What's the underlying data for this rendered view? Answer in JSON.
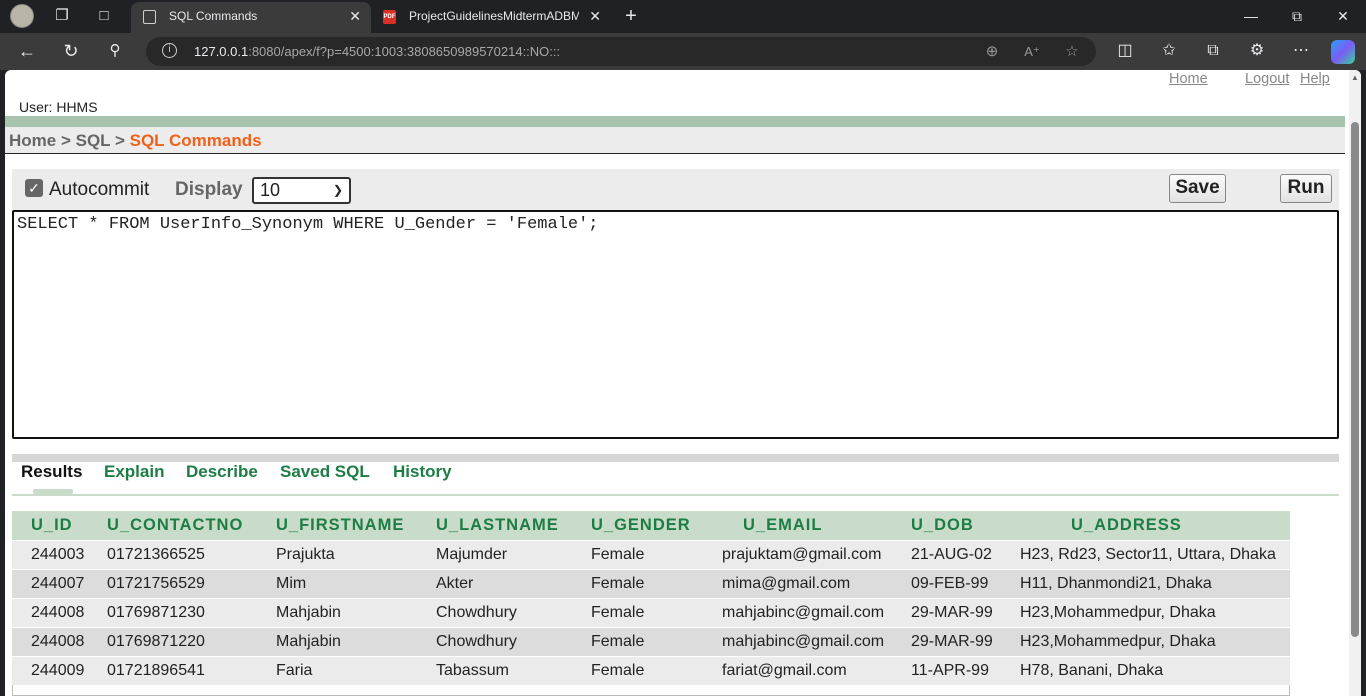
{
  "browser": {
    "tabs": [
      {
        "title": "SQL Commands",
        "active": true
      },
      {
        "title": "ProjectGuidelinesMidtermADBMS",
        "active": false
      }
    ],
    "url_host": "127.0.0.1",
    "url_rest": ":8080/apex/f?p=4500:1003:3808650989570214::NO:::"
  },
  "header": {
    "home_link": "Home",
    "logout_link": "Logout",
    "help_link": "Help",
    "user_label": "User: HHMS"
  },
  "breadcrumb": {
    "home": "Home",
    "sep1": " > ",
    "sql": "SQL",
    "sep2": " > ",
    "current": "SQL Commands"
  },
  "command": {
    "autocommit_label": "Autocommit",
    "autocommit_checked": true,
    "display_label": "Display",
    "display_value": "10",
    "save_label": "Save",
    "run_label": "Run",
    "sql_text": "SELECT * FROM UserInfo_Synonym WHERE U_Gender = 'Female';"
  },
  "result_tabs": [
    "Results",
    "Explain",
    "Describe",
    "Saved SQL",
    "History"
  ],
  "results": {
    "columns": [
      "U_ID",
      "U_CONTACTNO",
      "U_FIRSTNAME",
      "U_LASTNAME",
      "U_GENDER",
      "U_EMAIL",
      "U_DOB",
      "U_ADDRESS"
    ],
    "rows": [
      [
        "244003",
        "01721366525",
        "Prajukta",
        "Majumder",
        "Female",
        "prajuktam@gmail.com",
        "21-AUG-02",
        "H23, Rd23, Sector11, Uttara, Dhaka"
      ],
      [
        "244007",
        "01721756529",
        "Mim",
        "Akter",
        "Female",
        "mima@gmail.com",
        "09-FEB-99",
        "H11, Dhanmondi21, Dhaka"
      ],
      [
        "244008",
        "01769871230",
        "Mahjabin",
        "Chowdhury",
        "Female",
        "mahjabinc@gmail.com",
        "29-MAR-99",
        "H23,Mohammedpur, Dhaka"
      ],
      [
        "244008",
        "01769871220",
        "Mahjabin",
        "Chowdhury",
        "Female",
        "mahjabinc@gmail.com",
        "29-MAR-99",
        "H23,Mohammedpur, Dhaka"
      ],
      [
        "244009",
        "01721896541",
        "Faria",
        "Tabassum",
        "Female",
        "fariat@gmail.com",
        "11-APR-99",
        "H78, Banani, Dhaka"
      ]
    ]
  }
}
